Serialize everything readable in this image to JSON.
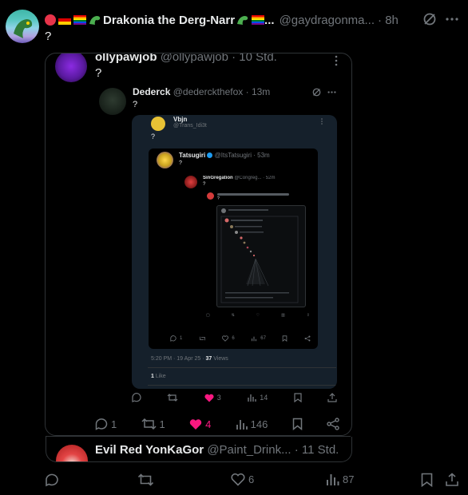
{
  "tweet": {
    "name": "Drakonia the Derg-Narr",
    "name_suffix": "...",
    "handle": "@gaydragonma...",
    "time": "· 8h",
    "text": "?",
    "actions": {
      "likes": "6",
      "views": "87"
    }
  },
  "quote1": {
    "name": "ollypawjob",
    "handle": "@ollypawjob",
    "time": "· 10 Std.",
    "text": "?",
    "actions": {
      "replies": "1",
      "retweets": "1",
      "likes": "4",
      "views": "146"
    }
  },
  "quote2": {
    "name": "Dederck",
    "handle": "@dederckthefox",
    "time": "· 13m",
    "text": "?"
  },
  "shot1": {
    "name": "Vbjn",
    "handle": "@Trans_Idi3t",
    "text": "?",
    "actions": {
      "likes": "3",
      "views": "14"
    },
    "footer_likes": "1",
    "footer_likes_label": "Like"
  },
  "shot2": {
    "name": "Tatsugiri",
    "handle": "@ItsTatsugiri",
    "time": "· 53m",
    "text": "?",
    "meta_time": "5:20 PM · 19 Apr 25 · ",
    "meta_views_num": "37",
    "meta_views_label": " Views",
    "actions": {
      "replies": "1",
      "likes": "6",
      "views": "67"
    }
  },
  "shot3": {
    "name": "SinGregation",
    "handle": "@Congreg...",
    "time": "· 52m",
    "text": "?"
  },
  "shot4": {
    "text": "?"
  },
  "next_tweet": {
    "name": "Evil Red YonKaGor",
    "handle": "@Paint_Drink...",
    "time": "· 11 Std."
  },
  "colors": {
    "background": "#000000",
    "text": "#e7e9ea",
    "muted": "#71767b",
    "like": "#f91880",
    "verified": "#1d9bf0",
    "card_bg": "#15202b"
  },
  "icons": [
    "grok-icon",
    "more-icon",
    "reply-icon",
    "retweet-icon",
    "like-icon",
    "views-icon",
    "bookmark-icon",
    "share-icon",
    "verified-icon"
  ]
}
